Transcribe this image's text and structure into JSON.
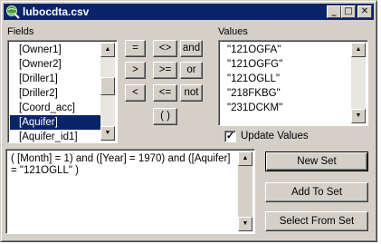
{
  "window": {
    "title": "lubocdta.csv",
    "icon": "arcview-globe-icon",
    "minimize_glyph": "_",
    "restore_glyph": "□",
    "close_glyph": "✕"
  },
  "fields": {
    "label": "Fields",
    "items": [
      "[Owner1]",
      "[Owner2]",
      "[Driller1]",
      "[Driller2]",
      "[Coord_acc]",
      "[Aquifer]",
      "[Aquifer_id1]"
    ],
    "selected": "[Aquifer]"
  },
  "operators": {
    "eq": "=",
    "ne": "<>",
    "and": "and",
    "gt": ">",
    "ge": ">=",
    "or": "or",
    "lt": "<",
    "le": "<=",
    "not": "not",
    "paren": "( )"
  },
  "values": {
    "label": "Values",
    "items": [
      "\"121OGFA\"",
      "\"121OGFG\"",
      "\"121OGLL\"",
      "\"218FKBG\"",
      "\"231DCKM\""
    ]
  },
  "update_values": {
    "label": "Update Values",
    "checked": true
  },
  "expression": {
    "text": "( [Month] = 1) and ([Year] = 1970) and ([Aquifer] = \"121OGLL\" )"
  },
  "buttons": {
    "new_set": "New Set",
    "add_to_set": "Add To Set",
    "select_from_set": "Select From Set"
  },
  "scroll_glyphs": {
    "up": "▲",
    "down": "▼"
  }
}
